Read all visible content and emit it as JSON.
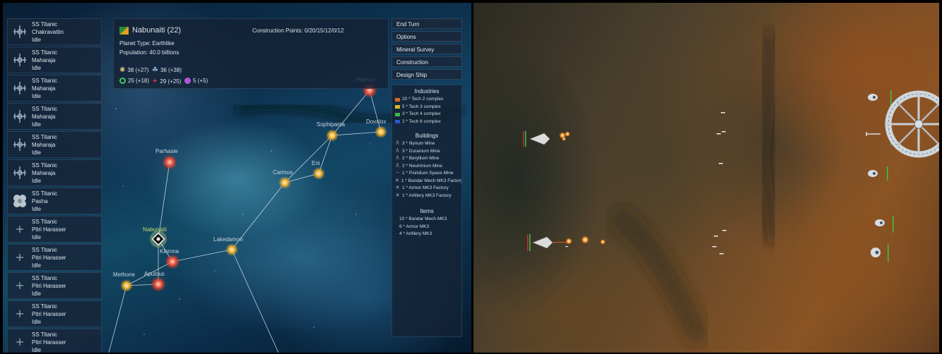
{
  "ship_list": [
    {
      "name": "SS Titanic",
      "class": "Chakravattin",
      "status": "Idle",
      "icon": "cross-hull-ship-icon"
    },
    {
      "name": "SS Titanic",
      "class": "Maharaja",
      "status": "Idle",
      "icon": "cross-hull-ship-icon"
    },
    {
      "name": "SS Titanic",
      "class": "Maharaja",
      "status": "Idle",
      "icon": "cross-hull-ship-icon"
    },
    {
      "name": "SS Titanic",
      "class": "Maharaja",
      "status": "Idle",
      "icon": "cross-hull-ship-icon"
    },
    {
      "name": "SS Titanic",
      "class": "Maharaja",
      "status": "Idle",
      "icon": "cross-hull-ship-icon"
    },
    {
      "name": "SS Titanic",
      "class": "Maharaja",
      "status": "Idle",
      "icon": "cross-hull-ship-icon"
    },
    {
      "name": "SS Titanic",
      "class": "Pasha",
      "status": "Idle",
      "icon": "pod-ship-icon"
    },
    {
      "name": "SS Titanic",
      "class": "Pitri Harasser",
      "status": "Idle",
      "icon": "small-ship-icon"
    },
    {
      "name": "SS Titanic",
      "class": "Pitri Harasser",
      "status": "Idle",
      "icon": "small-ship-icon"
    },
    {
      "name": "SS Titanic",
      "class": "Pitri Harasser",
      "status": "Idle",
      "icon": "small-ship-icon"
    },
    {
      "name": "SS Titanic",
      "class": "Pitri Harasser",
      "status": "Idle",
      "icon": "small-ship-icon"
    },
    {
      "name": "SS Titanic",
      "class": "Pitri Harasser",
      "status": "Idle",
      "icon": "small-ship-icon"
    }
  ],
  "planet": {
    "name": "Nabunaiti (22)",
    "construction": "Construction Points: 0/20/15/12/0/12",
    "type": "Planet Type: Earthlike",
    "population": "Population: 40.0 billions",
    "resources": [
      {
        "icon": "sun-icon",
        "value": "38 (+27)",
        "color": "#d9c27a"
      },
      {
        "icon": "cluster-icon",
        "value": "36 (+38)",
        "color": "#8fb4e6"
      },
      {
        "icon": "green-ring-icon",
        "value": "25 (+18)",
        "color": "#3ec85a"
      },
      {
        "icon": "red-star-icon",
        "value": "29 (+25)",
        "color": "#d8343a"
      },
      {
        "icon": "purple-orb-icon",
        "value": "5 (+5)",
        "color": "#b454d8"
      }
    ]
  },
  "menu": [
    "End Turn",
    "Options",
    "Mineral Survey",
    "Construction",
    "Design Ship"
  ],
  "industries": {
    "title": "Industries",
    "items": [
      {
        "label": "20 * Tech 2 complex",
        "color": "#d86a2a"
      },
      {
        "label": "5 * Tech 3 complex",
        "color": "#d8b82a"
      },
      {
        "label": "3 * Tech 4 complex",
        "color": "#3cb84a"
      },
      {
        "label": "2 * Tech 6 complex",
        "color": "#2a58c8"
      }
    ]
  },
  "buildings": {
    "title": "Buildings",
    "items": [
      {
        "label": "3 * Illyrium Mine",
        "glyph": "/\\"
      },
      {
        "label": "3 * Duranium Mine",
        "glyph": "/\\"
      },
      {
        "label": "2 * Beryllium Mine",
        "glyph": "/\\"
      },
      {
        "label": "2 * Neutrinium Mine",
        "glyph": "/\\"
      },
      {
        "label": "1 * Psiridium Space Mine",
        "glyph": "~"
      },
      {
        "label": "1 * Bandar Mech MK3 Factory",
        "glyph": "✕"
      },
      {
        "label": "1 * Armor MK3 Factory",
        "glyph": "✕"
      },
      {
        "label": "1 * Artillery MK3 Factory",
        "glyph": "✕"
      }
    ]
  },
  "items": {
    "title": "Items",
    "items": [
      "10 * Bandar Mech MK3",
      "6 * Armor MK3",
      "4 * Artillery MK3"
    ]
  },
  "systems": [
    {
      "name": "Pittinus",
      "color": "red"
    },
    {
      "name": "Dovxlox",
      "color": "yellow"
    },
    {
      "name": "Sophipania",
      "color": "yellow"
    },
    {
      "name": "Parhasie",
      "color": "red"
    },
    {
      "name": "Carmus",
      "color": "yellow"
    },
    {
      "name": "Eni",
      "color": "yellow"
    },
    {
      "name": "Nabunaiti",
      "color": "selected"
    },
    {
      "name": "Lakedamon",
      "color": "yellow"
    },
    {
      "name": "Kiomna",
      "color": "red"
    },
    {
      "name": "Methone",
      "color": "yellow"
    },
    {
      "name": "Apulous",
      "color": "red"
    }
  ]
}
